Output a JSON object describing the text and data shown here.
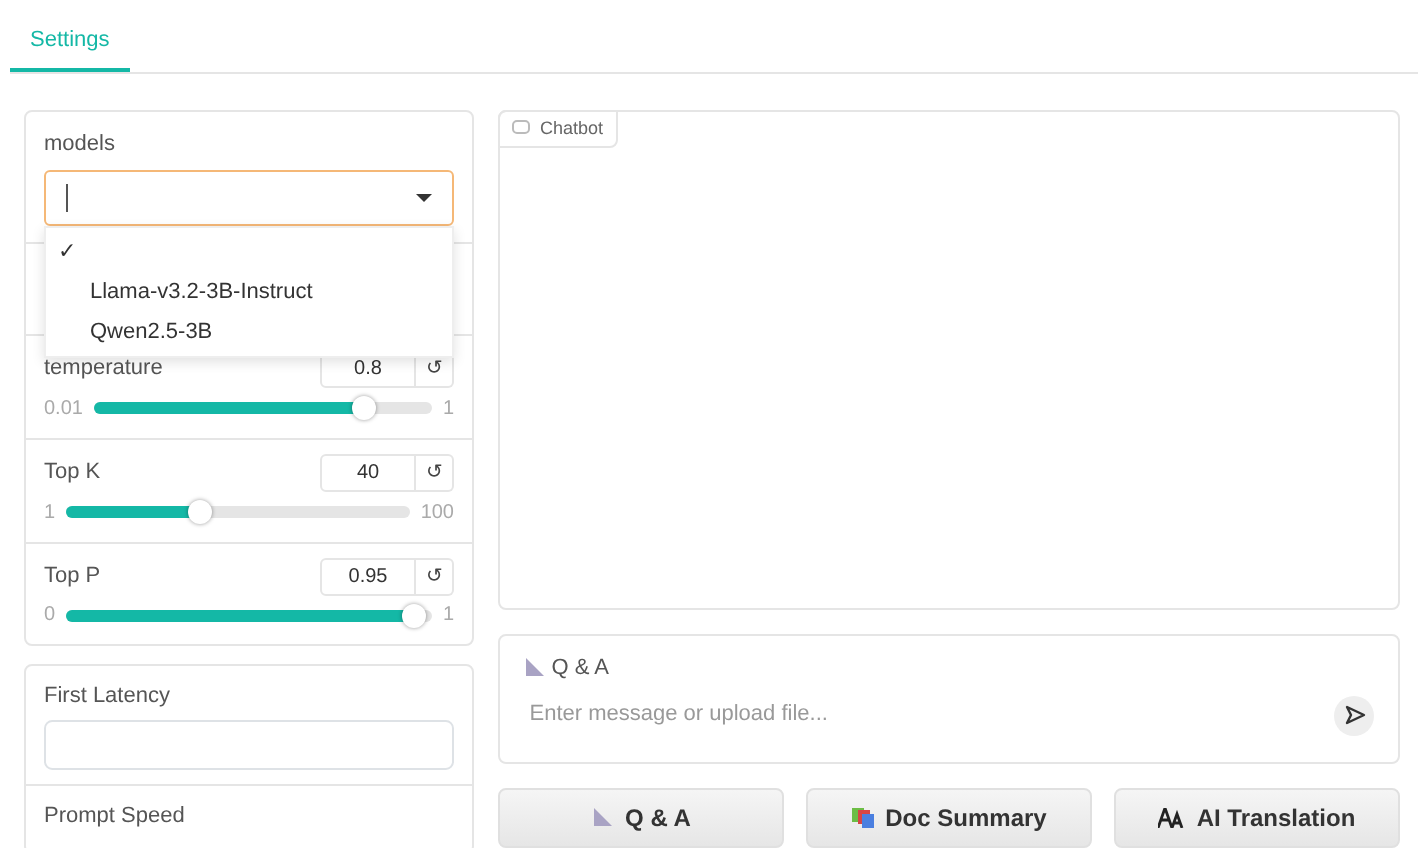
{
  "tabs": [
    {
      "label": "Settings",
      "selected": true
    }
  ],
  "models": {
    "label": "models",
    "options": [
      {
        "selected": true
      },
      {
        "label": "Llama-v3.2-3B-Instruct",
        "selected": false
      },
      {
        "label": "Qwen2.5-3B",
        "selected": false
      }
    ]
  },
  "sliders": [
    {
      "label": "temperature",
      "value": "0.8",
      "min": "0.01",
      "max": "1",
      "level": 0.8
    },
    {
      "label": "Top K",
      "value": "40",
      "min": "1",
      "max": "100",
      "level": 0.39
    },
    {
      "label": "Top P",
      "value": "0.95",
      "min": "0",
      "max": "1",
      "level": 0.95
    }
  ],
  "reset_symbol": "↺",
  "check_mark": "✓",
  "stats": [
    {
      "label": "First Latency",
      "kind": "field"
    },
    {
      "label": "Prompt Speed",
      "kind": "label"
    }
  ],
  "chatbot": {
    "label": "Chatbot"
  },
  "input": {
    "label": "Q & A",
    "placeholder": "Enter message or upload file..."
  },
  "modes": [
    {
      "label": "Q & A",
      "kind": "qa"
    },
    {
      "label": "Doc Summary",
      "kind": "summary"
    },
    {
      "label": "AI Translation",
      "kind": "translation"
    }
  ]
}
